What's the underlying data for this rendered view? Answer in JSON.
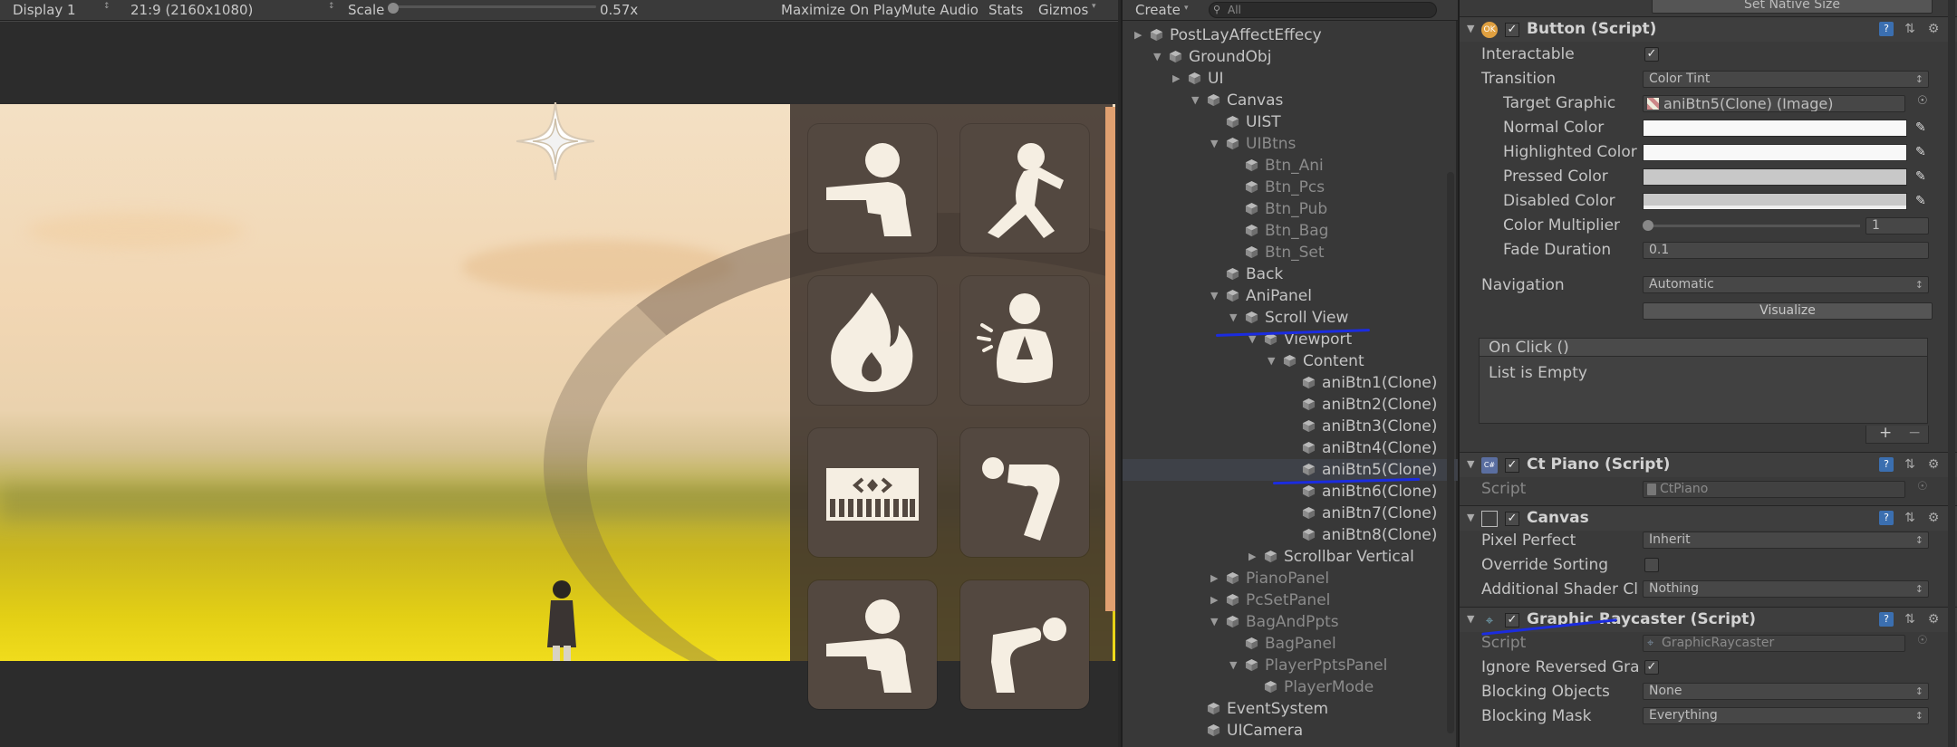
{
  "game_toolbar": {
    "display": "Display 1",
    "aspect": "21:9 (2160x1080)",
    "scale_label": "Scale",
    "scale_value": "0.57x",
    "maximize": "Maximize On Play",
    "mute": "Mute Audio",
    "stats": "Stats",
    "gizmos": "Gizmos"
  },
  "hierarchy": {
    "create": "Create",
    "search_placeholder": "All",
    "items": [
      {
        "label": "PostLayAffectEffecy"
      },
      {
        "label": "GroundObj"
      },
      {
        "label": "UI"
      },
      {
        "label": "Canvas"
      },
      {
        "label": "UIST"
      },
      {
        "label": "UIBtns"
      },
      {
        "label": "Btn_Ani"
      },
      {
        "label": "Btn_Pcs"
      },
      {
        "label": "Btn_Pub"
      },
      {
        "label": "Btn_Bag"
      },
      {
        "label": "Btn_Set"
      },
      {
        "label": "Back"
      },
      {
        "label": "AniPanel"
      },
      {
        "label": "Scroll View"
      },
      {
        "label": "Viewport"
      },
      {
        "label": "Content"
      },
      {
        "label": "aniBtn1(Clone)"
      },
      {
        "label": "aniBtn2(Clone)"
      },
      {
        "label": "aniBtn3(Clone)"
      },
      {
        "label": "aniBtn4(Clone)"
      },
      {
        "label": "aniBtn5(Clone)"
      },
      {
        "label": "aniBtn6(Clone)"
      },
      {
        "label": "aniBtn7(Clone)"
      },
      {
        "label": "aniBtn8(Clone)"
      },
      {
        "label": "Scrollbar Vertical"
      },
      {
        "label": "PianoPanel"
      },
      {
        "label": "PcSetPanel"
      },
      {
        "label": "BagAndPpts"
      },
      {
        "label": "BagPanel"
      },
      {
        "label": "PlayerPptsPanel"
      },
      {
        "label": "PlayerMode"
      },
      {
        "label": "EventSystem"
      },
      {
        "label": "UICamera"
      }
    ]
  },
  "inspector": {
    "set_native_size": "Set Native Size",
    "button": {
      "title": "Button (Script)",
      "interactable_label": "Interactable",
      "transition_label": "Transition",
      "transition_value": "Color Tint",
      "target_graphic_label": "Target Graphic",
      "target_graphic_value": "aniBtn5(Clone) (Image)",
      "normal_color_label": "Normal Color",
      "highlighted_color_label": "Highlighted Color",
      "pressed_color_label": "Pressed Color",
      "disabled_color_label": "Disabled Color",
      "color_multiplier_label": "Color Multiplier",
      "color_multiplier_value": "1",
      "fade_duration_label": "Fade Duration",
      "fade_duration_value": "0.1",
      "navigation_label": "Navigation",
      "navigation_value": "Automatic",
      "visualize": "Visualize",
      "on_click_label": "On Click ()",
      "list_empty": "List is Empty",
      "plus": "+",
      "minus": "−"
    },
    "ct_piano": {
      "title": "Ct Piano (Script)",
      "script_label": "Script",
      "script_value": "CtPiano"
    },
    "canvas": {
      "title": "Canvas",
      "pixel_perfect_label": "Pixel Perfect",
      "pixel_perfect_value": "Inherit",
      "override_sorting_label": "Override Sorting",
      "shader_channels_label": "Additional Shader Cl",
      "shader_channels_value": "Nothing"
    },
    "raycaster": {
      "title": "Graphic Raycaster (Script)",
      "script_label": "Script",
      "script_value": "GraphicRaycaster",
      "ignore_reversed_label": "Ignore Reversed Gra",
      "blocking_objects_label": "Blocking Objects",
      "blocking_objects_value": "None",
      "blocking_mask_label": "Blocking Mask",
      "blocking_mask_value": "Everything"
    }
  },
  "icons": {
    "ok_icon": "OK",
    "script_icon": "C#"
  },
  "colors": {
    "panel_bg": "#3a3a3a",
    "selection": "#3e4148",
    "annotation_pen": "#1b2ce0",
    "game_button_bg": "#534840",
    "game_icon_fill": "#f5eee2"
  }
}
